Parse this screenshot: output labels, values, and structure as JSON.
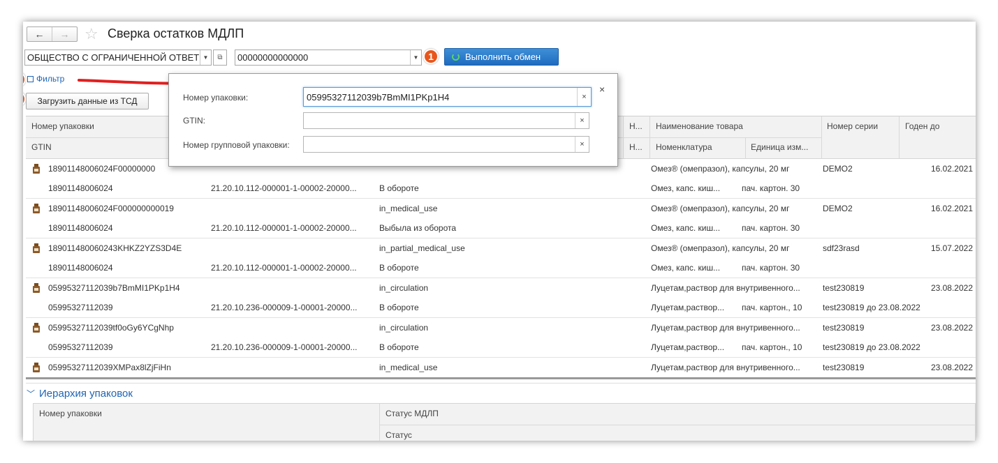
{
  "header": {
    "title": "Сверка остатков МДЛП",
    "back": "←",
    "forward": "→",
    "star": "☆"
  },
  "toolbar": {
    "organization": "ОБЩЕСТВО С ОГРАНИЧЕННОЙ ОТВЕТ",
    "place": "00000000000000",
    "exchange_label": "Выполнить обмен",
    "filter_label": "Фильтр",
    "load_label": "Загрузить данные из ТСД"
  },
  "badges": [
    "1",
    "2",
    "3"
  ],
  "columns": {
    "pack_number": "Номер упаковки",
    "gtin": "GTIN",
    "n_short_1": "Н...",
    "n_short_2": "Н...",
    "product_name": "Наименование товара",
    "nomenclature": "Номенклатура",
    "unit": "Единица изм...",
    "series": "Номер серии",
    "valid_until": "Годен до"
  },
  "rows": [
    {
      "pack": "18901148006024F00000000",
      "gtin": "18901148006024",
      "code": "21.20.10.112-000001-1-00002-20000...",
      "status_en": "",
      "status_ru": "В обороте",
      "name": "Омез® (омепразол), капсулы, 20 мг",
      "nom": "Омез, капс. киш...",
      "unit": "пач. картон. 30",
      "series": "DEMO2",
      "series2": "",
      "date": "16.02.2021"
    },
    {
      "pack": "18901148006024F000000000019",
      "gtin": "18901148006024",
      "code": "21.20.10.112-000001-1-00002-20000...",
      "status_en": "in_medical_use",
      "status_ru": "Выбыла из оборота",
      "name": "Омез® (омепразол), капсулы, 20 мг",
      "nom": "Омез, капс. киш...",
      "unit": "пач. картон. 30",
      "series": "DEMO2",
      "series2": "",
      "date": "16.02.2021"
    },
    {
      "pack": "189011480060243KHKZ2YZS3D4E",
      "gtin": "18901148006024",
      "code": "21.20.10.112-000001-1-00002-20000...",
      "status_en": "in_partial_medical_use",
      "status_ru": "В обороте",
      "name": "Омез® (омепразол), капсулы, 20 мг",
      "nom": "Омез, капс. киш...",
      "unit": "пач. картон. 30",
      "series": "sdf23rasd",
      "series2": "",
      "date": "15.07.2022"
    },
    {
      "pack": "05995327112039b7BmMI1PKp1H4",
      "gtin": "05995327112039",
      "code": "21.20.10.236-000009-1-00001-20000...",
      "status_en": "in_circulation",
      "status_ru": "В обороте",
      "name": "Луцетам,раствор для внутривенного...",
      "nom": "Луцетам,раствор...",
      "unit": "пач. картон., 10",
      "series": "test230819",
      "series2": "test230819 до 23.08.2022",
      "date": "23.08.2022"
    },
    {
      "pack": "05995327112039tf0oGy6YCgNhp",
      "gtin": "05995327112039",
      "code": "21.20.10.236-000009-1-00001-20000...",
      "status_en": "in_circulation",
      "status_ru": "В обороте",
      "name": "Луцетам,раствор для внутривенного...",
      "nom": "Луцетам,раствор...",
      "unit": "пач. картон., 10",
      "series": "test230819",
      "series2": "test230819 до 23.08.2022",
      "date": "23.08.2022"
    },
    {
      "pack": "05995327112039XMPax8lZjFiHn",
      "gtin": "",
      "code": "",
      "status_en": "in_medical_use",
      "status_ru": "",
      "name": "Луцетам,раствор для внутривенного...",
      "nom": "",
      "unit": "",
      "series": "test230819",
      "series2": "",
      "date": "23.08.2022"
    }
  ],
  "hierarchy": {
    "title": "Иерархия упаковок",
    "col_pack": "Номер упаковки",
    "col_status_mdlp": "Статус МДЛП",
    "col_status": "Статус"
  },
  "popup": {
    "pack_label": "Номер упаковки:",
    "pack_value": "05995327112039b7BmMI1PKp1H4",
    "gtin_label": "GTIN:",
    "gtin_value": "",
    "group_label": "Номер групповой упаковки:",
    "group_value": "",
    "clear": "×",
    "close": "×"
  },
  "colors": {
    "accent": "#1e64b4",
    "exchange_button": "#2a7bd0",
    "badge": "#e8561c",
    "arrow": "#e02020"
  },
  "icons": [
    "back-arrow-icon",
    "forward-arrow-icon",
    "star-icon",
    "dropdown-icon",
    "open-icon",
    "exchange-icon",
    "filter-icon",
    "medicine-bottle-icon",
    "close-icon",
    "clear-icon",
    "chevron-down-icon"
  ]
}
